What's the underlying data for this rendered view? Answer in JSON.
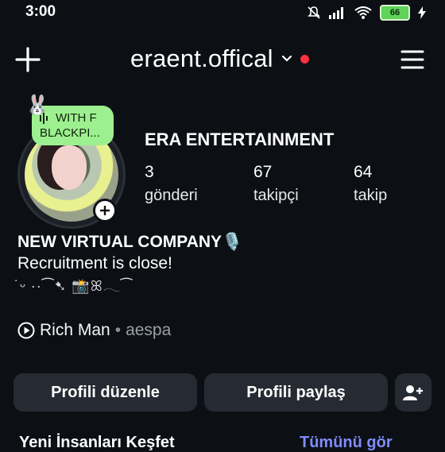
{
  "status_bar": {
    "time": "3:00",
    "battery": "66",
    "icons": [
      "mute-icon",
      "signal-icon",
      "wifi-icon",
      "battery-icon",
      "charging-icon"
    ]
  },
  "header": {
    "username": "eraent.offical",
    "icons": [
      "plus-icon",
      "chevron-down-icon",
      "menu-icon"
    ],
    "notification_dot_color": "#ff3040"
  },
  "note": {
    "line1": "WITH F",
    "line2": "BLACKPI..."
  },
  "profile": {
    "name": "ERA ENTERTAINMENT",
    "stats": [
      {
        "value": "3",
        "label": "gönderi"
      },
      {
        "value": "67",
        "label": "takipçi"
      },
      {
        "value": "64",
        "label": "takip"
      }
    ]
  },
  "bio": {
    "title": "NEW VIRTUAL COMPANY🎙️",
    "line": "Recruitment is close!",
    "deco": "˙ᵕ ··⁀➷ 📸ꕤ𓂃⁀"
  },
  "music": {
    "song": "Rich Man",
    "separator": "•",
    "artist": "aespa"
  },
  "buttons": {
    "edit": "Profili düzenle",
    "share": "Profili paylaş"
  },
  "discover": {
    "title": "Yeni İnsanları Keşfet",
    "see_all": "Tümünü gör"
  },
  "colors": {
    "background": "#0c0f14",
    "button": "#262b33",
    "note": "#9df08f",
    "link": "#7f8cff"
  }
}
